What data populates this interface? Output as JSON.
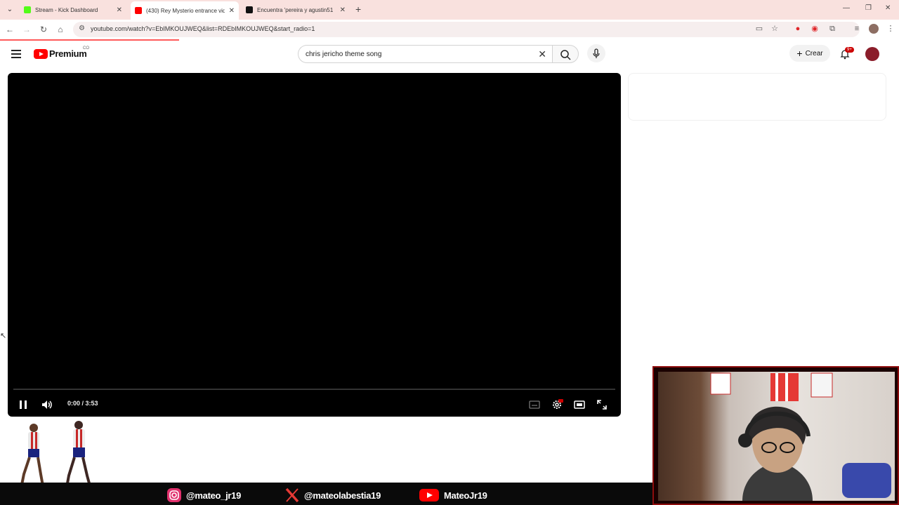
{
  "browser": {
    "tabs": [
      {
        "title": "Stream - Kick Dashboard",
        "close": "✕",
        "favicon_color": "#53fc18"
      },
      {
        "title": "(430) Rey Mysterio entrance vid",
        "close": "✕",
        "favicon_color": "#ff0000"
      },
      {
        "title": "Encuentra 'pereira y agustin51",
        "close": "✕",
        "favicon_color": "#111111"
      }
    ],
    "new_tab": "+",
    "url": "youtube.com/watch?v=EbIMKOUJWEQ&list=RDEbIMKOUJWEQ&start_radio=1"
  },
  "youtube": {
    "logo_text": "Premium",
    "country_code": "CO",
    "search_query": "chris jericho theme song",
    "create_label": "Crear",
    "notifications_badge": "9+",
    "player": {
      "time_label": "0:00 / 3:53",
      "progress": 0
    }
  },
  "overlay": {
    "socials": [
      {
        "platform": "instagram",
        "handle": "@mateo_jr19"
      },
      {
        "platform": "x",
        "handle": "@mateolabestia19"
      },
      {
        "platform": "youtube",
        "handle": "MateoJr19"
      }
    ]
  },
  "colors": {
    "tabstrip": "#f9e1de",
    "youtube_red": "#ff0000",
    "webcam_frame": "#8e0d0d"
  }
}
